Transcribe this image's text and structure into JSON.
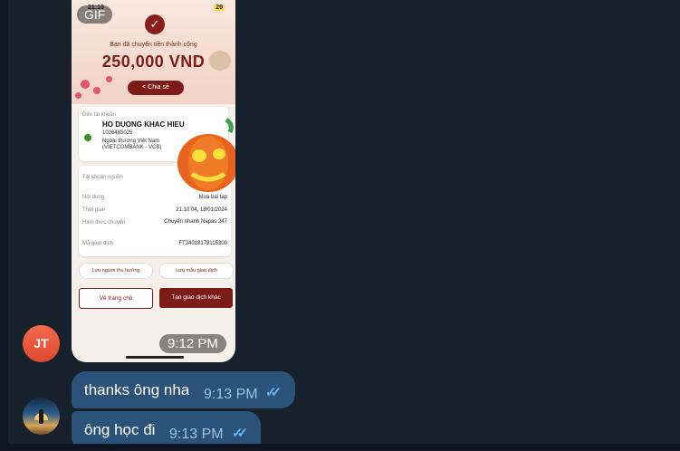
{
  "gif_message": {
    "badge": "GIF",
    "time": "9:12 PM",
    "status_time": "21:10",
    "battery": "29",
    "receipt": {
      "success_text": "Bạn đã chuyển tiền thành công",
      "amount": "250,000 VND",
      "share_label": "Chia sẻ",
      "to_account_label": "Đến tài khoản",
      "recipient_name": "HO DUONG KHAC HIEU",
      "account_number": "1026485025",
      "bank_name": "Ngoại thương Việt Nam (VIETCOMBANK - VCB)",
      "source_account_label": "Tài khoản nguồn",
      "rows": [
        {
          "label": "Nội dung",
          "value": "Mua bai tap"
        },
        {
          "label": "Thời gian",
          "value": "21:10:04, 18/01/2024"
        },
        {
          "label": "Hình thức chuyển",
          "value": "Chuyển nhanh Napas 247"
        },
        {
          "label": "Mã giao dịch",
          "value": "FT24018178115300"
        }
      ],
      "save_recipient_label": "Lưu người thụ hưởng",
      "save_template_label": "Lưu mẫu giao dịch",
      "home_button_label": "Về trang chủ",
      "new_transaction_label": "Tạo giao dịch khác"
    }
  },
  "avatars": {
    "sender_initials": "JT"
  },
  "messages": [
    {
      "text": "thanks ông nha",
      "time": "9:13 PM",
      "read": true
    },
    {
      "text": "ông học đi",
      "time": "9:13 PM",
      "read": true
    }
  ],
  "colors": {
    "background": "#17212b",
    "bubble": "#2b5278",
    "avatar_jt": "#e8553a",
    "brand_red": "#7c1b17",
    "read_ticks": "#6ab2f2"
  }
}
